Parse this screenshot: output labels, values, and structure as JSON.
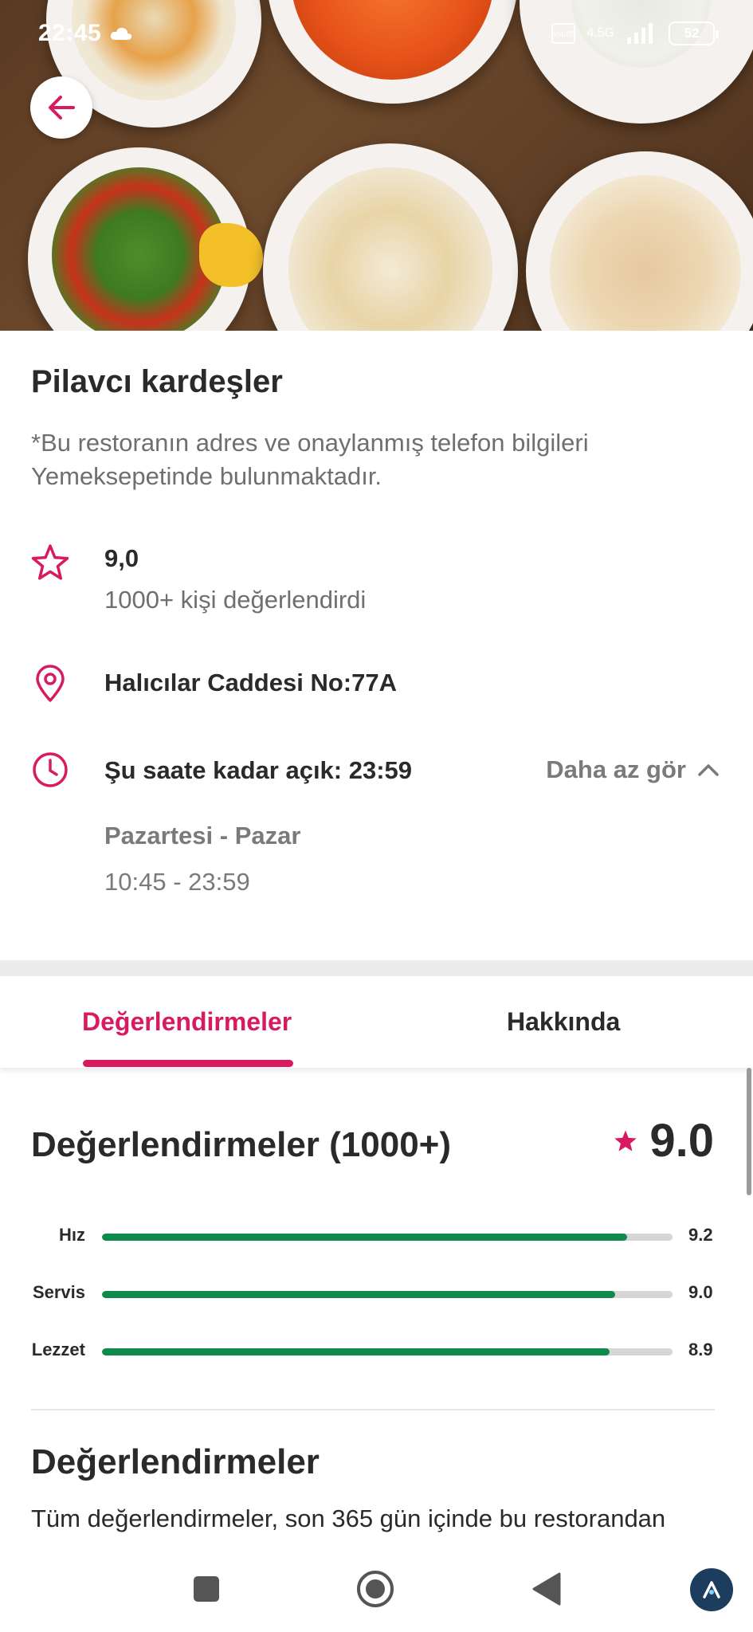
{
  "status_bar": {
    "time": "22:45",
    "network": "4.5G",
    "battery": "52"
  },
  "restaurant": {
    "name": "Pilavcı kardeşler",
    "note": "*Bu restoranın adres ve onaylanmış telefon bilgileri Yemeksepetinde bulunmaktadır.",
    "rating": "9,0",
    "rating_count": "1000+ kişi değerlendirdi",
    "address": "Halıcılar Caddesi No:77A",
    "open_until": "Şu saate kadar açık: 23:59",
    "toggle_label": "Daha az gör",
    "days": "Pazartesi - Pazar",
    "hours": "10:45 - 23:59"
  },
  "tabs": {
    "active": "Değerlendirmeler",
    "inactive": "Hakkında"
  },
  "reviews": {
    "title": "Değerlendirmeler (1000+)",
    "overall_score": "9.0",
    "bars": [
      {
        "label": "Hız",
        "value": "9.2",
        "fraction": 0.92
      },
      {
        "label": "Servis",
        "value": "9.0",
        "fraction": 0.9
      },
      {
        "label": "Lezzet",
        "value": "8.9",
        "fraction": 0.89
      }
    ],
    "section_title": "Değerlendirmeler",
    "section_text": "Tüm değerlendirmeler, son 365 gün içinde bu restorandan"
  },
  "colors": {
    "accent": "#d81b60",
    "bar_fill": "#0f8a4d",
    "bar_track": "#d6d6d6"
  },
  "icons": {
    "back": "arrow-left-icon",
    "rating": "star-outline-icon",
    "address": "location-pin-icon",
    "hours": "clock-icon",
    "toggle": "chevron-up-icon",
    "score": "star-filled-icon"
  }
}
